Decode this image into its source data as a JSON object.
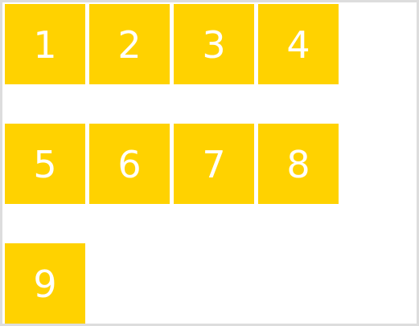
{
  "layout": {
    "tile_color": "#FFD200",
    "text_color": "#FFFFFF",
    "border_color": "#DDDDDD"
  },
  "items": [
    {
      "label": "1"
    },
    {
      "label": "2"
    },
    {
      "label": "3"
    },
    {
      "label": "4"
    },
    {
      "label": "5"
    },
    {
      "label": "6"
    },
    {
      "label": "7"
    },
    {
      "label": "8"
    },
    {
      "label": "9"
    }
  ]
}
